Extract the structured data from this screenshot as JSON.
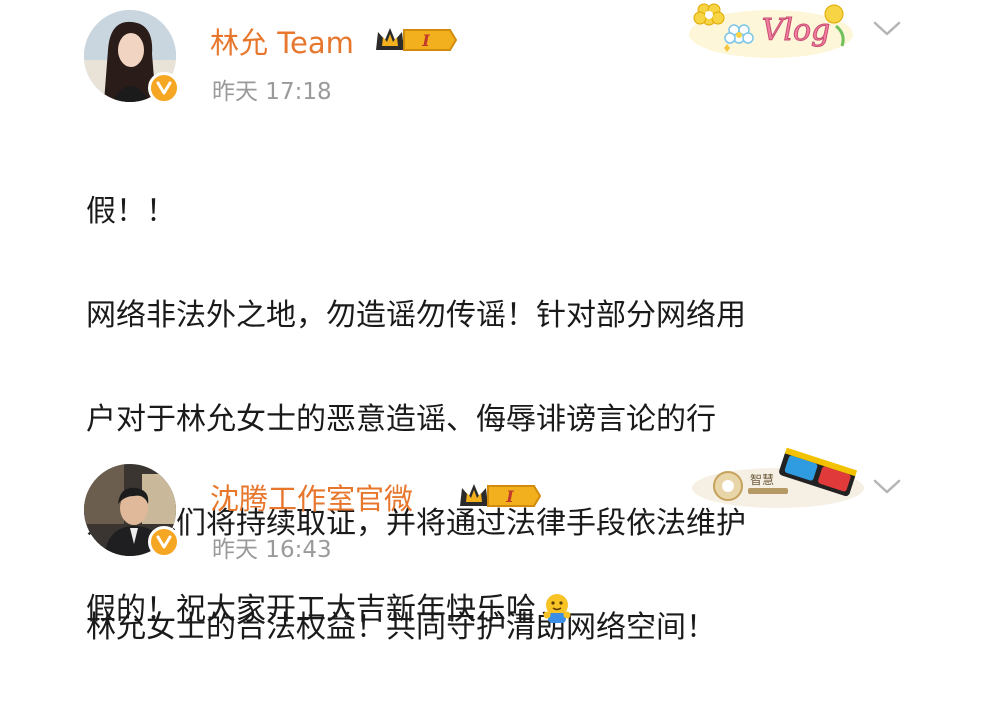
{
  "posts": [
    {
      "author": "林允 Team",
      "time": "昨天 17:18",
      "badge_text": "I",
      "content_lines": [
        "假！！",
        "网络非法外之地，勿造谣勿传谣！针对部分网络用",
        "户对于林允女士的恶意造谣、侮辱诽谤言论的行",
        "为，我们将持续取证，并将通过法律手段依法维护",
        "林允女士的合法权益！共同守护清朗网络空间！"
      ],
      "sticker_text": "Vlog"
    },
    {
      "author": "沈腾工作室官微",
      "time": "昨天 16:43",
      "badge_text": "I",
      "content_text": "假的！祝大家开工大吉新年快乐哈",
      "sticker_text": "智慧"
    }
  ],
  "icons": {
    "verified": "verified-icon",
    "crown_badge": "crown-badge-icon",
    "chevron": "chevron-down-icon",
    "emoji": "hug-emoji-icon",
    "sticker1": "vlog-flower-sticker",
    "sticker2": "3d-glasses-sticker"
  },
  "colors": {
    "name": "#e8772e",
    "time": "#9a9a9a",
    "verified": "#f5a623",
    "badge": "#f2b01e"
  }
}
